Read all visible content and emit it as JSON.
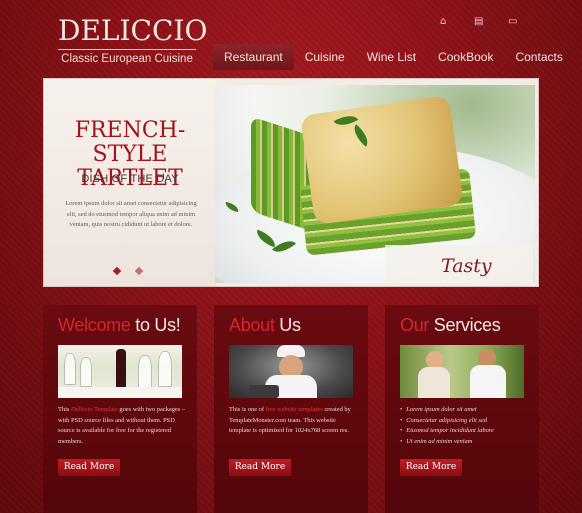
{
  "logo": {
    "title": "DELICCIO",
    "subtitle": "Classic European Cuisine"
  },
  "top_icons": [
    {
      "name": "home-icon",
      "glyph": "⌂"
    },
    {
      "name": "sitemap-icon",
      "glyph": "▤"
    },
    {
      "name": "mail-icon",
      "glyph": "▭"
    }
  ],
  "nav": {
    "items": [
      "Restaurant",
      "Cuisine",
      "Wine List",
      "CookBook",
      "Contacts"
    ],
    "active_index": 0
  },
  "hero": {
    "title_line1": "FRENCH-STYLE",
    "title_line2": "TARTLET",
    "subtitle": "DISH OF THE DAY",
    "text": "Lorem ipsum dolor sit amet consectetur adipisicing elit, sed do eiusmod tempor aliqua enim ad minim veniam, quis nostru cididunt ut labore et dolore.",
    "badge": "Tasty",
    "slides_count": 2,
    "active_slide": 0
  },
  "panels": [
    {
      "title_highlight": "Welcome",
      "title_rest": " to Us!",
      "image": "wine-glasses-photo",
      "text_parts": [
        "This ",
        "Deliccio Template",
        " goes with two packages – with PSD source files and without them. PSD source is available for free for the registered members."
      ],
      "button": "Read More"
    },
    {
      "title_highlight": "About",
      "title_rest": " Us",
      "image": "chef-photo",
      "text_parts": [
        "This is one of ",
        "free website templates",
        " created by TemplateMonster.com team. This website template is optimized for 1024x768 screen res."
      ],
      "button": "Read More"
    },
    {
      "title_highlight": "Our",
      "title_rest": " Services",
      "image": "couple-dining-photo",
      "services": [
        "Lorem ipsum dolor sit amet",
        "Consectetur adipisicing elit sed",
        "Eiusmod tempor incididunt labore",
        "Ut enim ad minim veniam"
      ],
      "button": "Read More"
    }
  ],
  "colors": {
    "brand_red": "#a2141b",
    "background": "#8a1117",
    "panel": "#5e080c",
    "button": "#c01d24"
  }
}
